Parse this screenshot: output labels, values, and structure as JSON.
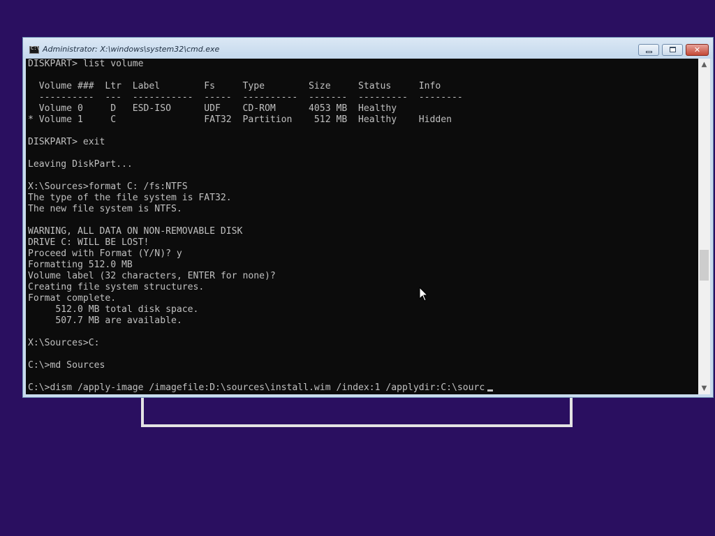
{
  "desktop": {
    "background_color": "#2a0f60"
  },
  "window": {
    "title": "Administrator: X:\\windows\\system32\\cmd.exe",
    "icon": "cmd-icon",
    "icon_text": "C:\\",
    "buttons": {
      "minimize": "minimize-icon",
      "maximize": "maximize-icon",
      "close": "close-icon",
      "close_glyph": "✕"
    }
  },
  "console": {
    "text": "DISKPART> list volume\n\n  Volume ###  Ltr  Label        Fs     Type        Size     Status     Info\n  ----------  ---  -----------  -----  ----------  -------  ---------  --------\n  Volume 0     D   ESD-ISO      UDF    CD-ROM      4053 MB  Healthy\n* Volume 1     C                FAT32  Partition    512 MB  Healthy    Hidden\n\nDISKPART> exit\n\nLeaving DiskPart...\n\nX:\\Sources>format C: /fs:NTFS\nThe type of the file system is FAT32.\nThe new file system is NTFS.\n\nWARNING, ALL DATA ON NON-REMOVABLE DISK\nDRIVE C: WILL BE LOST!\nProceed with Format (Y/N)? y\nFormatting 512.0 MB\nVolume label (32 characters, ENTER for none)?\nCreating file system structures.\nFormat complete.\n     512.0 MB total disk space.\n     507.7 MB are available.\n\nX:\\Sources>C:\n\nC:\\>md Sources\n\nC:\\>dism /apply-image /imagefile:D:\\sources\\install.wim /index:1 /applydir:C:\\sourc",
    "text_color": "#c0c0c0",
    "background_color": "#0c0c0c"
  },
  "scrollbar": {
    "up_arrow": "▲",
    "down_arrow": "▼"
  }
}
